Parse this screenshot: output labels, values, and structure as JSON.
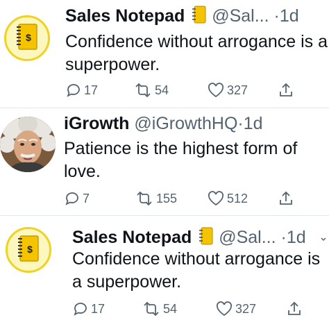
{
  "tweets": [
    {
      "name": "Sales Notepad",
      "handle": "@Sal...",
      "dot": "·",
      "time": "1d",
      "text": "Confidence without arrogance is a superpower.",
      "replies": "17",
      "retweets": "54",
      "likes": "327",
      "avatar": "notepad-dollar-icon",
      "badge": "notebook-emoji-icon"
    },
    {
      "name": "iGrowth",
      "handle": "@iGrowthHQ",
      "dot": "·",
      "time": "1d",
      "text": "Patience is the highest form of love.",
      "replies": "7",
      "retweets": "155",
      "likes": "512",
      "avatar": "einstein-portrait"
    },
    {
      "name": "Sales Notepad",
      "handle": "@Sal...",
      "dot": "·",
      "time": "1d",
      "text": "Confidence without arrogance is a superpower.",
      "replies": "17",
      "retweets": "54",
      "likes": "327",
      "avatar": "notepad-dollar-icon",
      "badge": "notebook-emoji-icon"
    }
  ],
  "colors": {
    "text": "#0f1419",
    "muted": "#536471",
    "divider": "#e1e8ed",
    "avatar_ring": "#f0d321",
    "notebook_yellow": "#f5c400"
  }
}
